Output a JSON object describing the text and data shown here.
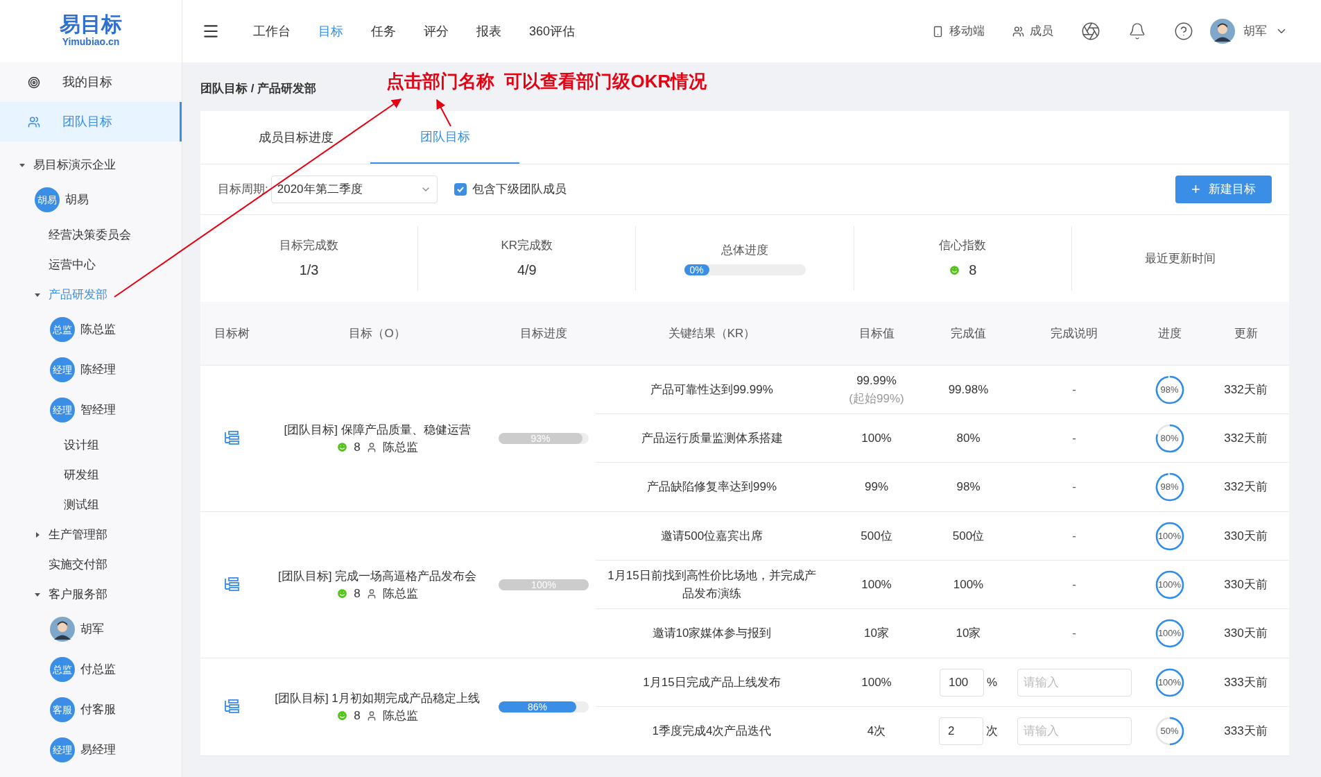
{
  "sidebar": {
    "logo": {
      "title": "易目标",
      "subtitle": "Yimubiao.cn"
    },
    "nav": [
      {
        "label": "我的目标",
        "selected": false
      },
      {
        "label": "团队目标",
        "selected": true
      }
    ],
    "tree": [
      {
        "label": "易目标演示企业",
        "kind": "dept",
        "expanded": true,
        "selected": false,
        "children": [
          {
            "label": "胡易",
            "kind": "member",
            "badge": "胡易"
          },
          {
            "label": "经营决策委员会",
            "kind": "unit",
            "selected": false
          },
          {
            "label": "运营中心",
            "kind": "unit",
            "selected": false
          },
          {
            "label": "产品研发部",
            "kind": "dept",
            "expanded": true,
            "selected": true,
            "children": [
              {
                "label": "陈总监",
                "kind": "member",
                "badge": "总监"
              },
              {
                "label": "陈经理",
                "kind": "member",
                "badge": "经理"
              },
              {
                "label": "智经理",
                "kind": "member",
                "badge": "经理"
              },
              {
                "label": "设计组",
                "kind": "unit",
                "selected": false
              },
              {
                "label": "研发组",
                "kind": "unit",
                "selected": false
              },
              {
                "label": "测试组",
                "kind": "unit",
                "selected": false
              }
            ]
          },
          {
            "label": "生产管理部",
            "kind": "dept",
            "expanded": false,
            "selected": false
          },
          {
            "label": "实施交付部",
            "kind": "unit",
            "selected": false
          },
          {
            "label": "客户服务部",
            "kind": "dept",
            "expanded": true,
            "selected": false,
            "children": [
              {
                "label": "胡军",
                "kind": "person"
              },
              {
                "label": "付总监",
                "kind": "member",
                "badge": "总监"
              },
              {
                "label": "付客服",
                "kind": "member",
                "badge": "客服"
              },
              {
                "label": "易经理",
                "kind": "member",
                "badge": "经理"
              }
            ]
          }
        ]
      }
    ]
  },
  "header": {
    "menu": [
      {
        "label": "工作台",
        "selected": false
      },
      {
        "label": "目标",
        "selected": true
      },
      {
        "label": "任务",
        "selected": false
      },
      {
        "label": "评分",
        "selected": false
      },
      {
        "label": "报表",
        "selected": false
      },
      {
        "label": "360评估",
        "selected": false
      }
    ],
    "mobile": "移动端",
    "members": "成员",
    "user": "胡军"
  },
  "annotation": "点击部门名称  可以查看部门级OKR情况",
  "breadcrumb": "团队目标 / 产品研发部",
  "tabs": [
    {
      "label": "成员目标进度",
      "selected": false
    },
    {
      "label": "团队目标",
      "selected": true
    }
  ],
  "filter": {
    "label": "目标周期:",
    "period": "2020年第二季度",
    "include_sub": {
      "label": "包含下级团队成员",
      "checked": true
    },
    "new_button": "新建目标",
    "new_icon": "+"
  },
  "stats": [
    {
      "label": "目标完成数",
      "kind": "fraction",
      "done": "1",
      "total": "/3"
    },
    {
      "label": "KR完成数",
      "kind": "fraction",
      "done": "4",
      "total": "/9"
    },
    {
      "label": "总体进度",
      "kind": "progress",
      "reading": "0%"
    },
    {
      "label": "信心指数",
      "kind": "confidence",
      "value": "8"
    },
    {
      "label": "最近更新时间",
      "kind": "empty"
    }
  ],
  "table": {
    "columns": [
      "目标树",
      "目标（O）",
      "目标进度",
      "关键结果（KR）",
      "目标值",
      "完成值",
      "完成说明",
      "进度",
      "更新"
    ],
    "groups": [
      {
        "title": "[团队目标] 保障产品质量、稳健运营",
        "confidence": "8",
        "owner": "陈总监",
        "level": 0.93,
        "reading": "93%",
        "color": "#cccccc",
        "krs": [
          {
            "kr": "产品可靠性达到99.99%",
            "target": "99.99%",
            "start": "(起始99%)",
            "kind": "text",
            "done": "99.98%",
            "note": "-",
            "level": 0.98,
            "reading": "98%",
            "updated": "332天前"
          },
          {
            "kr": "产品运行质量监测体系搭建",
            "target": "100%",
            "kind": "text",
            "done": "80%",
            "note": "-",
            "level": 0.8,
            "reading": "80%",
            "updated": "332天前"
          },
          {
            "kr": "产品缺陷修复率达到99%",
            "target": "99%",
            "kind": "text",
            "done": "98%",
            "note": "-",
            "level": 0.98,
            "reading": "98%",
            "updated": "332天前"
          }
        ]
      },
      {
        "title": "[团队目标] 完成一场高逼格产品发布会",
        "confidence": "8",
        "owner": "陈总监",
        "level": 1,
        "reading": "100%",
        "color": "#cccccc",
        "krs": [
          {
            "kr": "邀请500位嘉宾出席",
            "target": "500位",
            "kind": "text",
            "done": "500位",
            "note": "-",
            "level": 1,
            "reading": "100%",
            "updated": "330天前"
          },
          {
            "kr": "1月15日前找到高性价比场地，并完成产品发布演练",
            "target": "100%",
            "kind": "text",
            "done": "100%",
            "note": "-",
            "level": 1,
            "reading": "100%",
            "updated": "330天前"
          },
          {
            "kr": "邀请10家媒体参与报到",
            "target": "10家",
            "kind": "text",
            "done": "10家",
            "note": "-",
            "level": 1,
            "reading": "100%",
            "updated": "330天前"
          }
        ]
      },
      {
        "title": "[团队目标] 1月初如期完成产品稳定上线",
        "confidence": "8",
        "owner": "陈总监",
        "level": 0.86,
        "reading": "86%",
        "color": "#3a8ee6",
        "krs": [
          {
            "kr": "1月15日完成产品上线发布",
            "target": "100%",
            "kind": "input",
            "done": "100",
            "unit": "%",
            "placeholder": "请输入",
            "level": 1,
            "reading": "100%",
            "updated": "333天前"
          },
          {
            "kr": "1季度完成4次产品迭代",
            "target": "4次",
            "kind": "input",
            "done": "2",
            "unit": "次",
            "placeholder": "请输入",
            "level": 0.5,
            "reading": "50%",
            "updated": "333天前"
          }
        ]
      }
    ]
  }
}
